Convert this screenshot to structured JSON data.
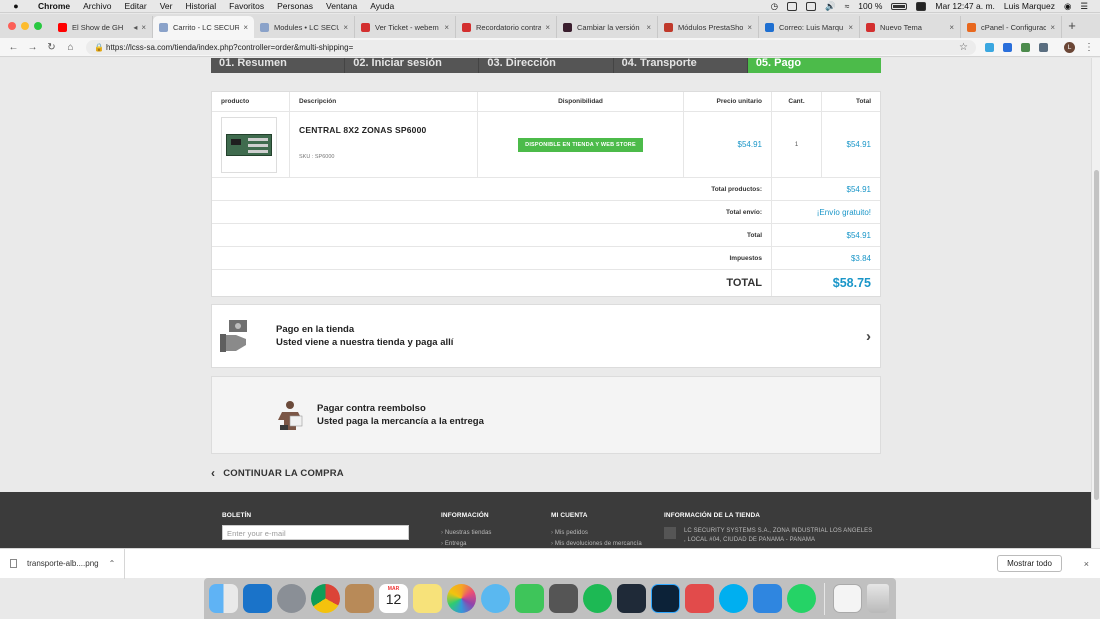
{
  "menubar": {
    "apple": "",
    "items": [
      "Chrome",
      "Archivo",
      "Editar",
      "Ver",
      "Historial",
      "Favoritos",
      "Personas",
      "Ventana",
      "Ayuda"
    ],
    "battery": "100 %",
    "datetime": "Mar 12:47 a. m.",
    "user": "Luis Marquez"
  },
  "tabs": [
    {
      "title": "El Show de GH",
      "color": "#ff0000"
    },
    {
      "title": "Carrito - LC SECURITY",
      "color": "#8aa2c9",
      "active": true
    },
    {
      "title": "Modules • LC SECU",
      "color": "#8aa2c9"
    },
    {
      "title": "Ver Ticket - webem",
      "color": "#d32f2f"
    },
    {
      "title": "Recordatorio contra",
      "color": "#d32f2f"
    },
    {
      "title": "Cambiar la versión",
      "color": "#3a1e2e"
    },
    {
      "title": "Módulos PrestaSho",
      "color": "#c0392b"
    },
    {
      "title": "Correo: Luis Marqu",
      "color": "#1e6fd1"
    },
    {
      "title": "Nuevo Tema",
      "color": "#d32f2f"
    },
    {
      "title": "cPanel - Configurac",
      "color": "#e8681e"
    }
  ],
  "address": {
    "url": "https://lcss-sa.com/tienda/index.php?controller=order&multi-shipping=",
    "profile_initial": "L"
  },
  "steps": [
    "01. Resumen",
    "02. Iniciar sesión",
    "03. Dirección",
    "04. Transporte",
    "05. Pago"
  ],
  "cart": {
    "headers": {
      "product": "producto",
      "description": "Descripción",
      "availability": "Disponibilidad",
      "unit_price": "Precio unitario",
      "qty": "Cant.",
      "total": "Total"
    },
    "item": {
      "name": "CENTRAL 8X2 ZONAS SP6000",
      "sku": "SKU : SP6000",
      "availability": "DISPONIBLE EN TIENDA Y WEB STORE",
      "unit_price": "$54.91",
      "qty": "1",
      "total": "$54.91"
    },
    "summary": [
      {
        "label": "Total productos:",
        "value": "$54.91"
      },
      {
        "label": "Total envío:",
        "value": "¡Envío gratuito!"
      },
      {
        "label": "Total",
        "value": "$54.91"
      },
      {
        "label": "Impuestos",
        "value": "$3.84"
      }
    ],
    "grand": {
      "label": "TOTAL",
      "value": "$58.75"
    }
  },
  "payments": [
    {
      "title": "Pago en la tienda",
      "subtitle": "Usted viene a nuestra tienda y paga allí"
    },
    {
      "title": "Pagar contra reembolso",
      "subtitle": "Usted paga la mercancía a la entrega"
    }
  ],
  "continue_label": "CONTINUAR LA COMPRA",
  "footer": {
    "newsletter_title": "BOLETÍN",
    "newsletter_placeholder": "Enter your e-mail",
    "info_title": "INFORMACIÓN",
    "info_links": [
      "Nuestras tiendas",
      "Entrega"
    ],
    "account_title": "MI CUENTA",
    "account_links": [
      "Mis pedidos",
      "Mis devoluciones de mercancía"
    ],
    "store_title": "INFORMACIÓN DE LA TIENDA",
    "store_address": "LC SECURITY SYSTEMS S.A., ZONA INDUSTRIAL LOS ANGELES , LOCAL #04, CIUDAD DE PANAMA - PANAMA"
  },
  "downloads": {
    "file": "transporte-alb....png",
    "show_all": "Mostrar todo"
  },
  "dock": {
    "calendar_month": "MAR",
    "calendar_day": "12",
    "icons": [
      "finder-icon",
      "outlook-icon",
      "launchpad-icon",
      "chrome-icon",
      "notes-icon",
      "calendar-icon",
      "stickies-icon",
      "photos-icon",
      "messages-icon",
      "facetime-icon",
      "screenshot-icon",
      "spotify-icon",
      "wg-app-icon",
      "photoshop-icon",
      "screen-record-icon",
      "skype-icon",
      "airdrop-icon",
      "whatsapp-icon",
      "preview-icon",
      "trash-icon"
    ]
  }
}
